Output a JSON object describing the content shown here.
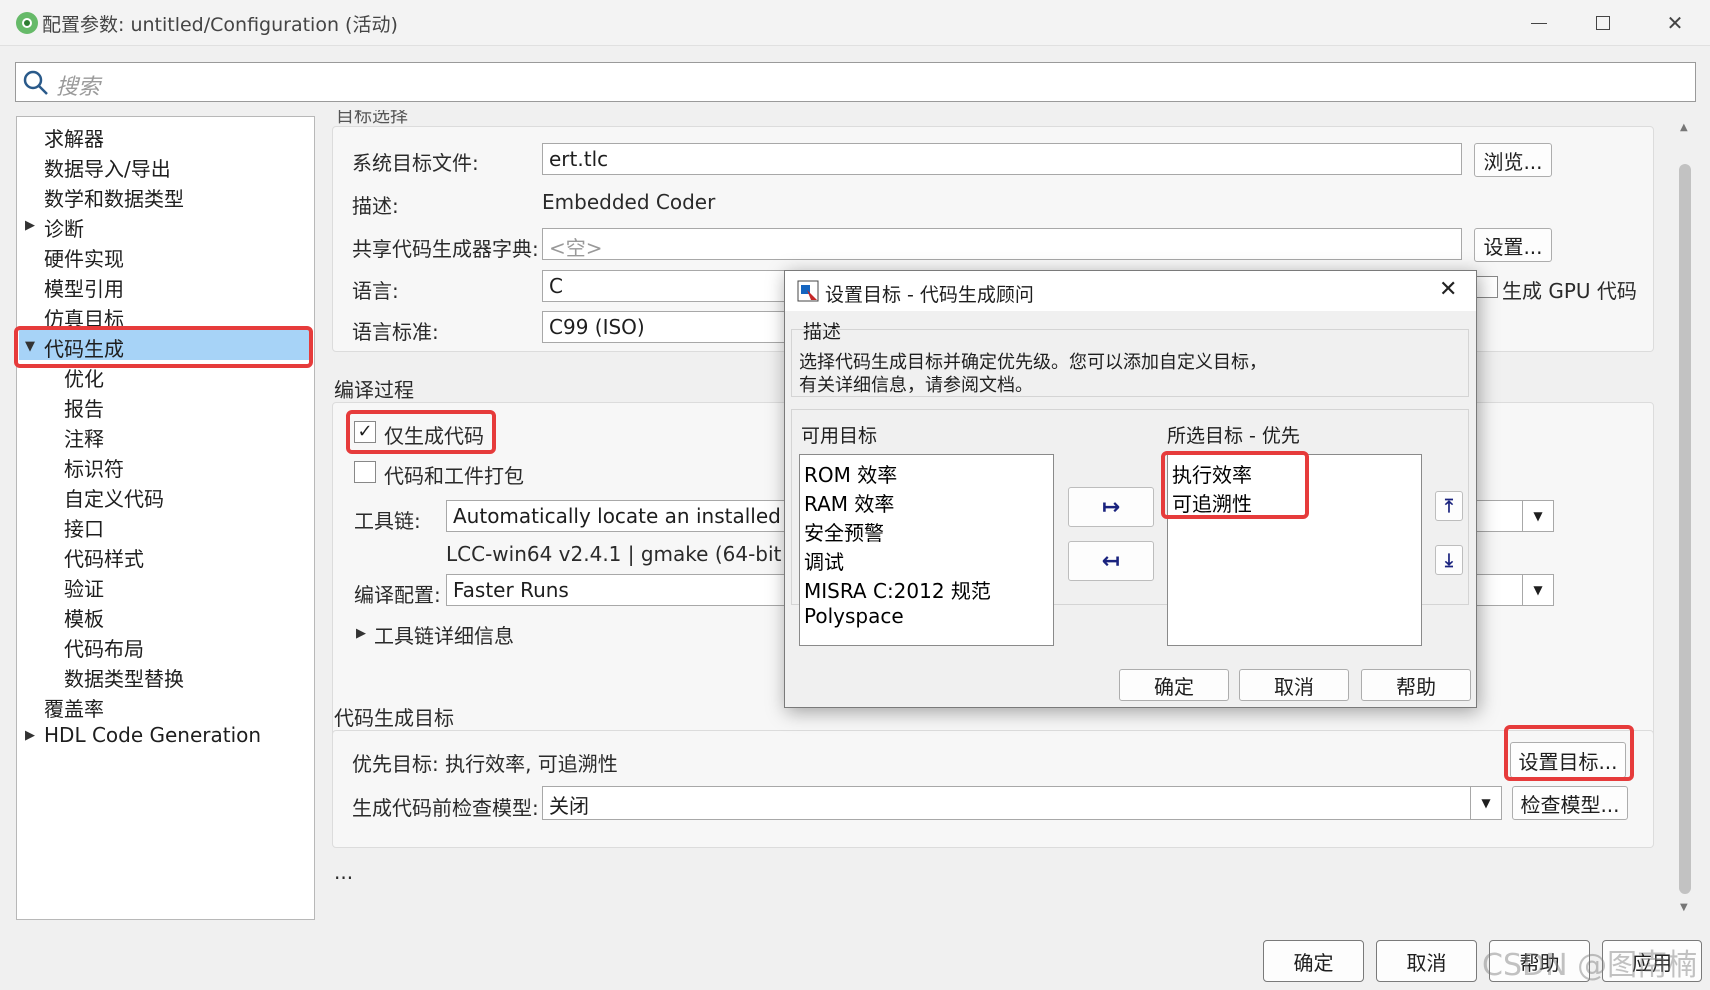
{
  "window": {
    "title": "配置参数: untitled/Configuration (活动)",
    "minimize_icon": "minimize-icon",
    "maximize_icon": "maximize-icon",
    "close_icon": "close-icon"
  },
  "search": {
    "placeholder": "搜索"
  },
  "tree": {
    "items": [
      {
        "label": "求解器"
      },
      {
        "label": "数据导入/导出"
      },
      {
        "label": "数学和数据类型"
      },
      {
        "label": "诊断"
      },
      {
        "label": "硬件实现"
      },
      {
        "label": "模型引用"
      },
      {
        "label": "仿真目标"
      },
      {
        "label": "代码生成"
      },
      {
        "label": "优化"
      },
      {
        "label": "报告"
      },
      {
        "label": "注释"
      },
      {
        "label": "标识符"
      },
      {
        "label": "自定义代码"
      },
      {
        "label": "接口"
      },
      {
        "label": "代码样式"
      },
      {
        "label": "验证"
      },
      {
        "label": "模板"
      },
      {
        "label": "代码布局"
      },
      {
        "label": "数据类型替换"
      },
      {
        "label": "覆盖率"
      },
      {
        "label": "HDL Code Generation"
      }
    ],
    "selected": "代码生成"
  },
  "target_section": {
    "header_partial": "目标选择",
    "system_target_label": "系统目标文件:",
    "system_target_value": "ert.tlc",
    "browse_button": "浏览...",
    "description_label": "描述:",
    "description_value": "Embedded Coder",
    "shared_dict_label": "共享代码生成器字典:",
    "shared_dict_value": "<空>",
    "shared_dict_button": "设置...",
    "language_label": "语言:",
    "language_value": "C",
    "gpu_label": "生成 GPU 代码",
    "lang_std_label": "语言标准:",
    "lang_std_value": "C99 (ISO)"
  },
  "build_section": {
    "header": "编译过程",
    "gen_code_only_label": "仅生成代码",
    "gen_code_only_checked": true,
    "package_label": "代码和工件打包",
    "package_checked": false,
    "toolchain_label": "工具链:",
    "toolchain_value": "Automatically locate an installed toolch",
    "toolchain_info": "LCC-win64 v2.4.1 | gmake (64-bit Wind",
    "build_config_label": "编译配置:",
    "build_config_value": "Faster Runs",
    "toolchain_details": "工具链详细信息"
  },
  "objectives_section": {
    "header": "代码生成目标",
    "priority_label": "优先目标: 执行效率, 可追溯性",
    "set_objectives_button": "设置目标...",
    "check_model_label": "生成代码前检查模型:",
    "check_model_value": "关闭",
    "check_model_button": "检查模型..."
  },
  "ellipsis": "...",
  "dialog": {
    "title": "设置目标 - 代码生成顾问",
    "description_header": "描述",
    "description_line1": "选择代码生成目标并确定优先级。您可以添加自定义目标，",
    "description_line2": "有关详细信息，请参阅文档。",
    "available_header": "可用目标",
    "available_items": [
      "ROM 效率",
      "RAM 效率",
      "安全预警",
      "调试",
      "MISRA C:2012 规范",
      "Polyspace"
    ],
    "selected_header": "所选目标 - 优先",
    "selected_items": [
      "执行效率",
      "可追溯性"
    ],
    "ok_button": "确定",
    "cancel_button": "取消",
    "help_button": "帮助"
  },
  "bottom": {
    "ok_button": "确定",
    "cancel_button": "取消",
    "help_button": "帮助",
    "apply_button": "应用"
  },
  "watermark": "CSDN @图南楠",
  "colors": {
    "selection": "#a7d3f7",
    "highlight_box": "#e63b3b",
    "arrow_icon": "#1a237e"
  }
}
